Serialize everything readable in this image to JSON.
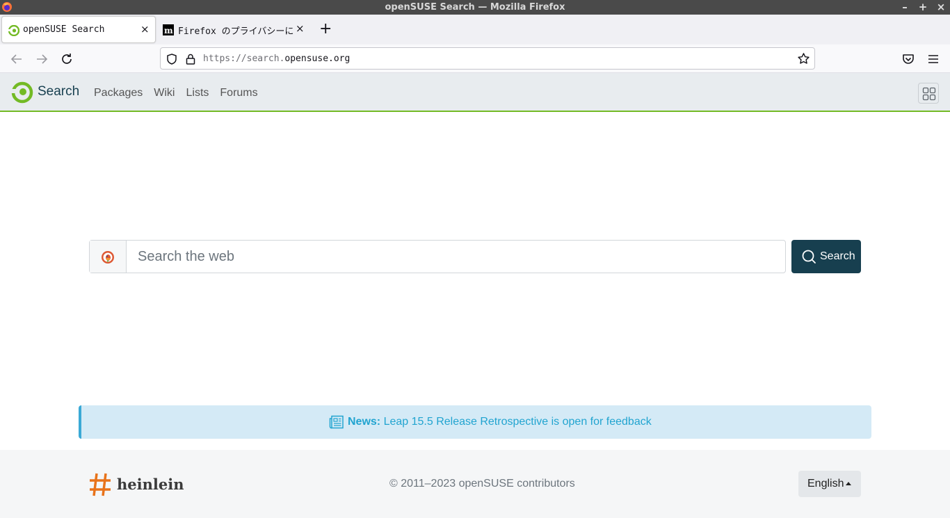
{
  "window": {
    "title": "openSUSE Search — Mozilla Firefox",
    "controls": [
      "–",
      "+",
      "×"
    ]
  },
  "tabs": [
    {
      "label": "openSUSE Search",
      "active": true,
      "close": "×"
    },
    {
      "label": "Firefox のプライバシーに関",
      "active": false,
      "close": "×"
    }
  ],
  "newtab_label": "+",
  "navbar": {
    "url_prefix": "https://search.",
    "url_domain": "opensuse.org"
  },
  "site": {
    "brand": "Search",
    "brand_color": "#73ba25",
    "nav_links": [
      "Packages",
      "Wiki",
      "Lists",
      "Forums"
    ]
  },
  "search": {
    "placeholder": "Search the web",
    "button_label": "Search",
    "button_color": "#173f4f"
  },
  "news": {
    "label": "News:",
    "text": "Leap 15.5 Release Retrospective is open for feedback"
  },
  "footer": {
    "sponsor": "heinlein",
    "copyright": "© 2011–2023 openSUSE contributors",
    "language": "English"
  }
}
